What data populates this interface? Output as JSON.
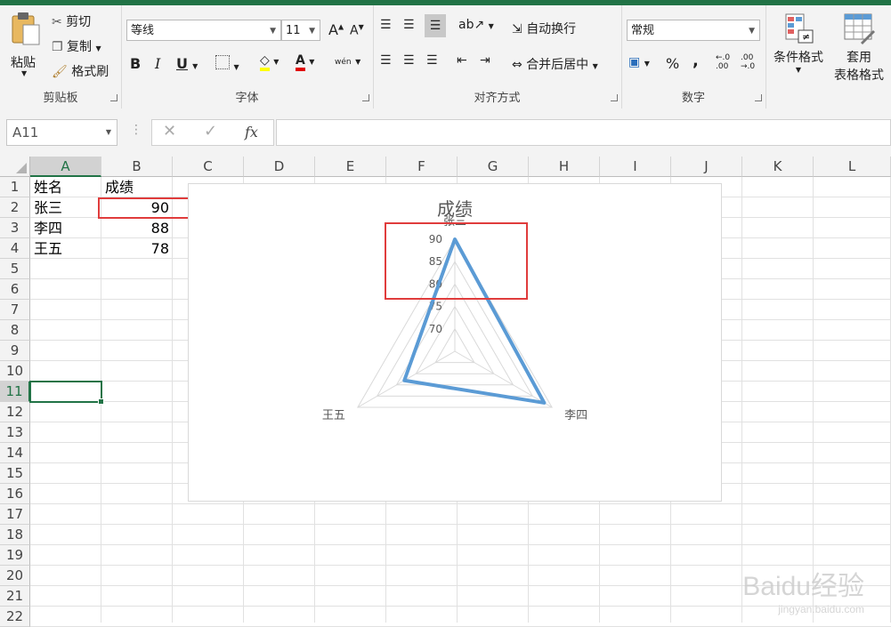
{
  "ribbon": {
    "clipboard": {
      "label": "剪贴板",
      "paste": "粘贴",
      "cut": "剪切",
      "copy": "复制",
      "format_painter": "格式刷"
    },
    "font": {
      "label": "字体",
      "font_name": "等线",
      "font_size": "11",
      "bold": "B",
      "italic": "I",
      "underline": "U",
      "phonetic": "wén"
    },
    "alignment": {
      "label": "对齐方式",
      "wrap_text": "自动换行",
      "merge_center": "合并后居中"
    },
    "number": {
      "label": "数字",
      "format": "常规",
      "percent": "%",
      "comma": ","
    },
    "styles": {
      "conditional": "条件格式",
      "table_line1": "套用",
      "table_line2": "表格格式"
    }
  },
  "formula_bar": {
    "name_box": "A11",
    "fx": "fx",
    "formula": ""
  },
  "columns": [
    "A",
    "B",
    "C",
    "D",
    "E",
    "F",
    "G",
    "H",
    "I",
    "J",
    "K",
    "L"
  ],
  "rows": [
    "1",
    "2",
    "3",
    "4",
    "5",
    "6",
    "7",
    "8",
    "9",
    "10",
    "11",
    "12",
    "13",
    "14",
    "15",
    "16",
    "17",
    "18",
    "19",
    "20",
    "21",
    "22"
  ],
  "cells": {
    "A1": "姓名",
    "B1": "成绩",
    "A2": "张三",
    "B2": "90",
    "A3": "李四",
    "B3": "88",
    "A4": "王五",
    "B4": "78"
  },
  "chart_data": {
    "type": "radar",
    "title": "成绩",
    "categories": [
      "张三",
      "李四",
      "王五"
    ],
    "series": [
      {
        "values": [
          90,
          88,
          78
        ],
        "color": "#5b9bd5"
      }
    ],
    "ticks": [
      70,
      75,
      80,
      85,
      90
    ],
    "rlim": [
      65,
      90
    ]
  },
  "watermark": {
    "brand": "Baidu经验",
    "url": "jingyan.baidu.com"
  },
  "colors": {
    "accent": "#217346",
    "highlight": "#e03c3c",
    "series": "#5b9bd5"
  }
}
